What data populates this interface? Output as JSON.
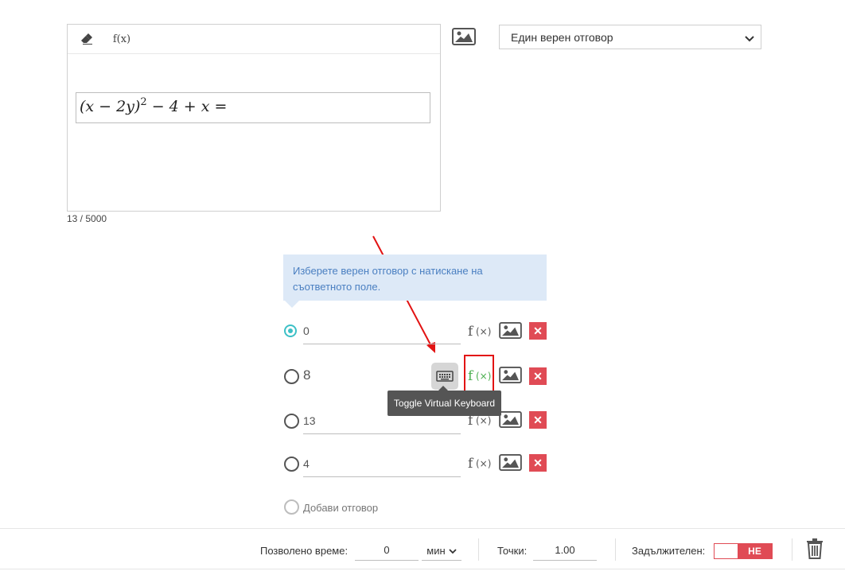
{
  "editor": {
    "toolbar": {
      "fx_label": "f(x)"
    },
    "formula": {
      "part1": "(x − 2y)",
      "exp": "2",
      "part2": " − 4 + x ="
    },
    "char_count": "13 / 5000"
  },
  "answer_type": {
    "selected": "Един верен отговор"
  },
  "hint": "Изберете верен отговор с натискане на съответното поле.",
  "answers": [
    {
      "value": "0",
      "checked": true
    },
    {
      "value": "8",
      "checked": false
    },
    {
      "value": "13",
      "checked": false
    },
    {
      "value": "4",
      "checked": false
    }
  ],
  "tooltip": "Toggle Virtual Keyboard",
  "add_answer": "Добави отговор",
  "footer": {
    "time_label": "Позволено време:",
    "time_value": "0",
    "time_unit": "мин",
    "points_label": "Точки:",
    "points_value": "1.00",
    "required_label": "Задължителен:",
    "required_value": "НЕ"
  },
  "colors": {
    "accent": "#3cc0c6",
    "delete": "#e04b55",
    "fx_active": "#4caf50",
    "annotation": "#e21313"
  }
}
